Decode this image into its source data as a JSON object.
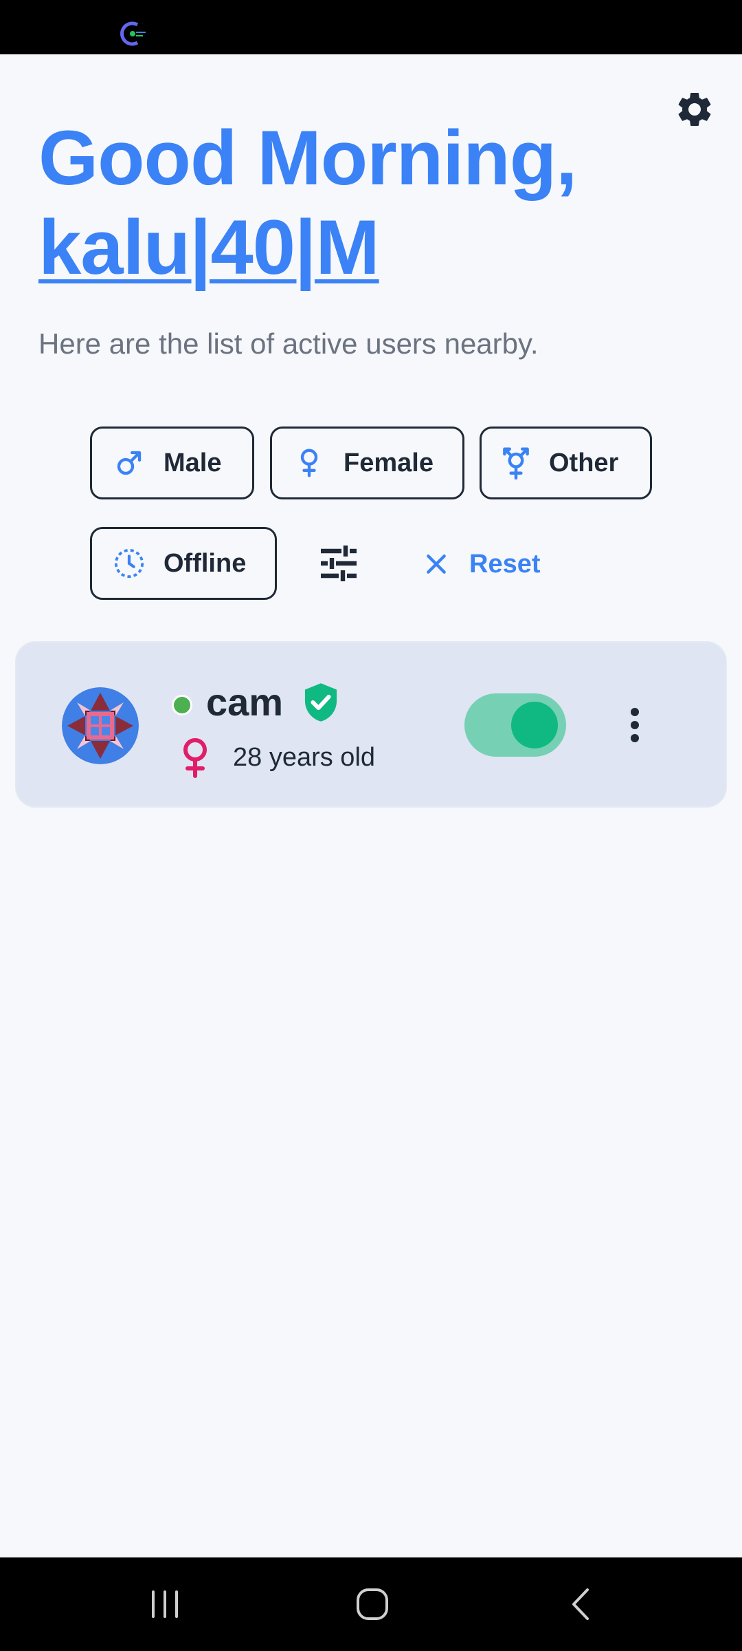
{
  "greeting": {
    "line1": "Good Morning,",
    "user_name": "kalu|40|M"
  },
  "subtitle": "Here are the list of active users nearby.",
  "filters": {
    "male": "Male",
    "female": "Female",
    "other": "Other",
    "offline": "Offline",
    "reset": "Reset"
  },
  "users": [
    {
      "name": "cam",
      "age_text": "28 years old",
      "online": true,
      "verified": true,
      "gender": "female",
      "toggle_on": true
    }
  ],
  "icons": {
    "settings": "gear-icon",
    "filter_settings": "sliders-icon",
    "reset": "close-icon",
    "more": "more-vertical-icon"
  },
  "colors": {
    "accent": "#3b82f6",
    "text_dark": "#1f2937",
    "text_muted": "#6b7280",
    "card_bg": "#dfe5f2",
    "verified_green": "#10b981",
    "online_green": "#4caf50",
    "female_pink": "#e11d68"
  }
}
